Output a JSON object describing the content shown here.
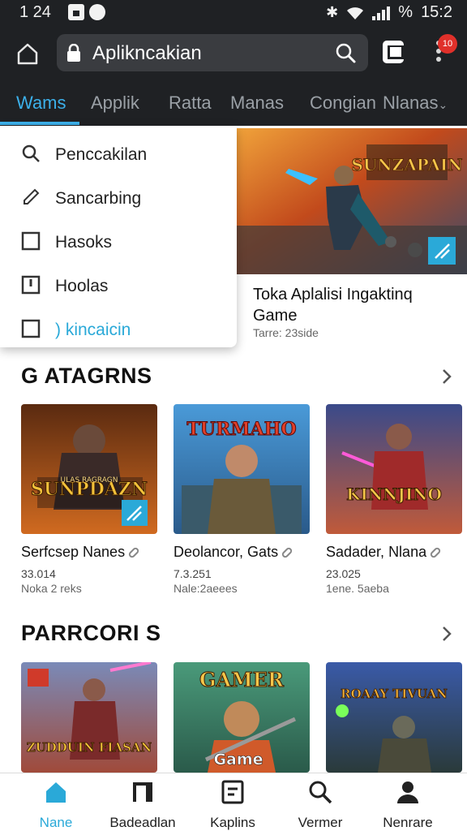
{
  "status": {
    "time": "1 24",
    "clock": "15:2",
    "percent": "%"
  },
  "browser": {
    "url": "Aplikncakian",
    "notif_count": "10"
  },
  "tabs": [
    {
      "label": "Wams",
      "active": true
    },
    {
      "label": "Applik"
    },
    {
      "label": "Ratta"
    },
    {
      "label": "Manas"
    },
    {
      "label": "Congian"
    },
    {
      "label": "Nlanas"
    }
  ],
  "dropdown": [
    {
      "label": "Penccakilan",
      "icon": "search-icon"
    },
    {
      "label": "Sancarbing",
      "icon": "pen-icon"
    },
    {
      "label": "Hasoks",
      "icon": "checkbox-icon"
    },
    {
      "label": "Hoolas",
      "icon": "bookmark-icon"
    },
    {
      "label": ") kincaicin",
      "icon": "checkbox-icon"
    }
  ],
  "hero": {
    "title": "Toka Aplalisi Ingaktinq Game",
    "subtitle": "Tarre: 23side",
    "art_text": "SUNZAPAIN"
  },
  "section1": {
    "title": "G ATAGRNS",
    "cards": [
      {
        "name": "Serfcsep Nanes",
        "meta1": "33.014",
        "meta2": "Noka 2 reks",
        "art": "SUNPDAZN",
        "art_sub": "ULAS RAGRAGN"
      },
      {
        "name": "Deolancor, Gats",
        "meta1": "7.3.251",
        "meta2": "Nale:2aeees",
        "art": "TURMAHO",
        "art_sub": ""
      },
      {
        "name": "Sadader, Nlana",
        "meta1": "23.025",
        "meta2": "1ene. 5aeba",
        "art": "KINNJINO",
        "art_sub": ""
      }
    ]
  },
  "section2": {
    "title": "PARRCORI S",
    "cards": [
      {
        "art": "ZUDDUIN FIASAN"
      },
      {
        "art": "GAMER",
        "art_sub": "Game"
      },
      {
        "art": "ROAAY TIVUAN"
      }
    ]
  },
  "bottom_nav": [
    {
      "label": "Nane",
      "icon": "home-icon",
      "active": true
    },
    {
      "label": "Badeadlan",
      "icon": "library-icon"
    },
    {
      "label": "Kaplins",
      "icon": "document-icon"
    },
    {
      "label": "Vermer",
      "icon": "search-icon"
    },
    {
      "label": "Nenrare",
      "icon": "person-icon"
    }
  ],
  "colors": {
    "accent": "#3cb0ea",
    "header_bg": "#1f2124",
    "urlbar_bg": "#3a3c40"
  }
}
